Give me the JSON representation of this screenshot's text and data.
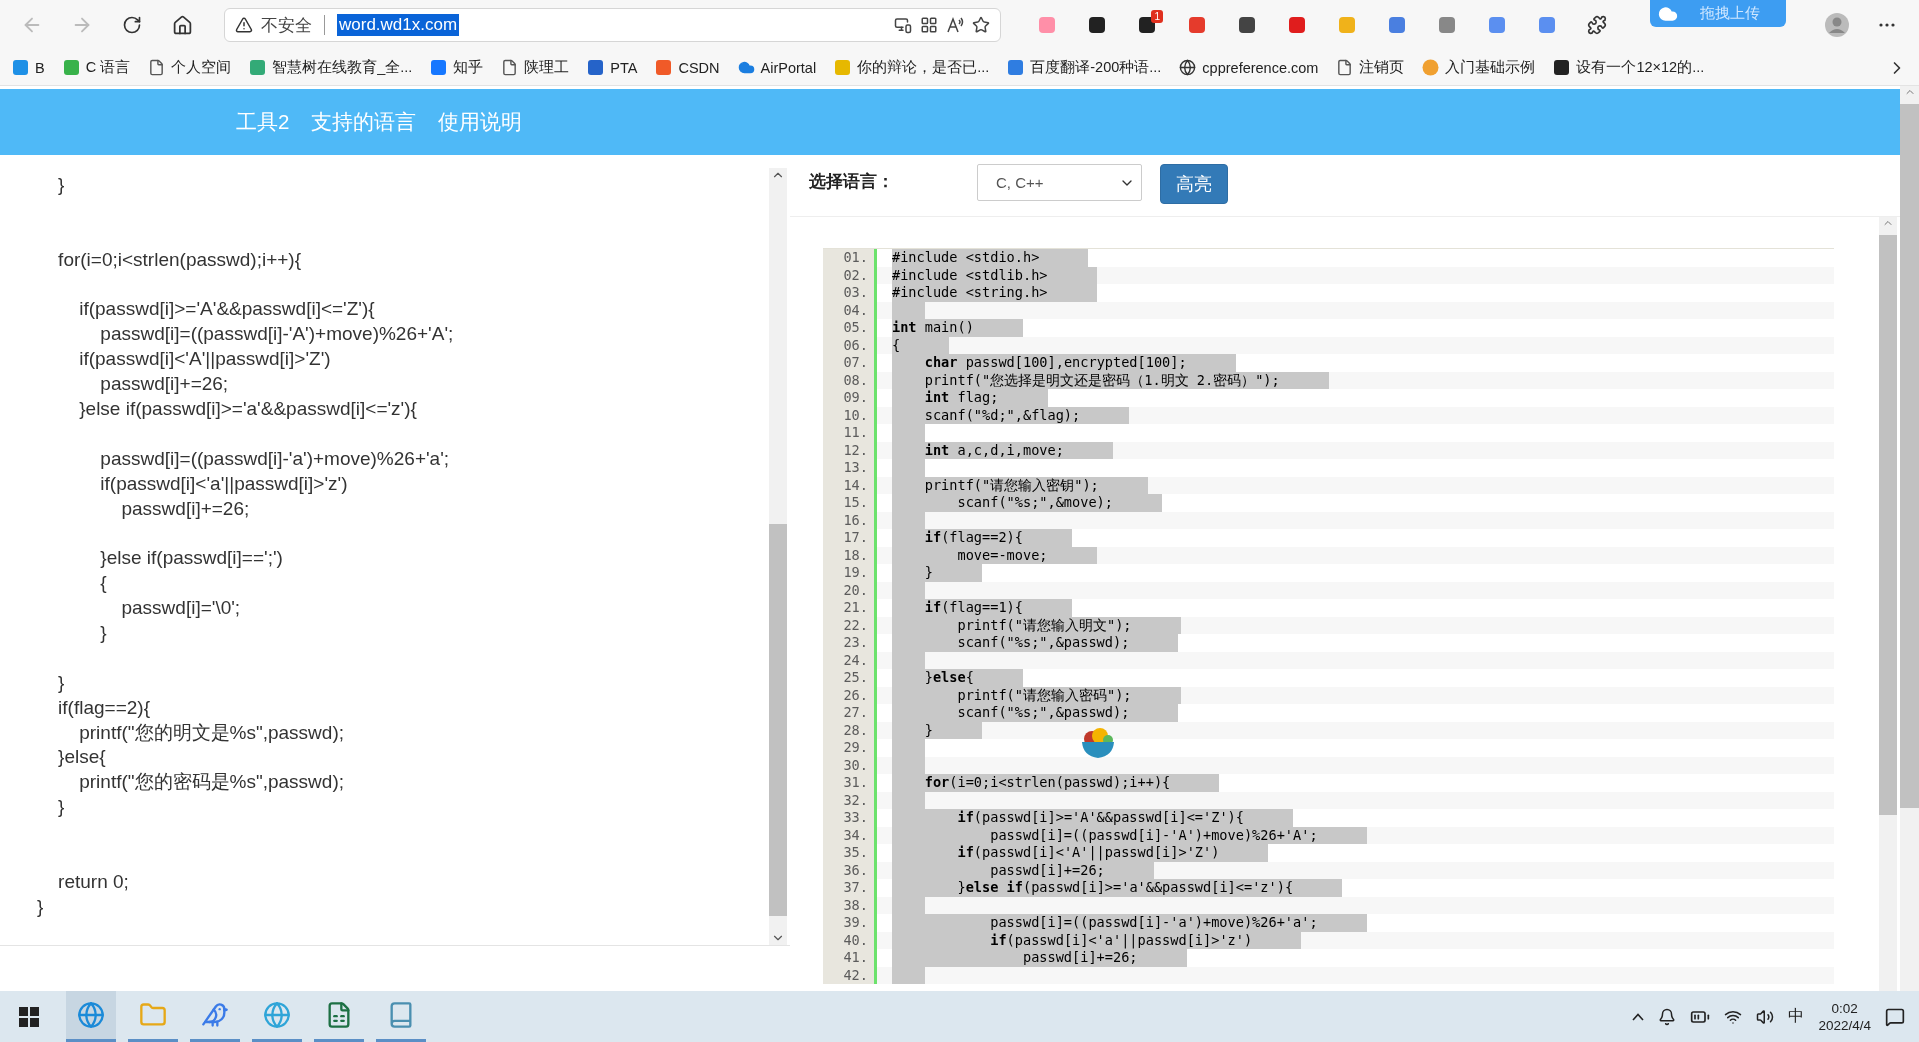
{
  "browser": {
    "security_label": "不安全",
    "url": "word.wd1x.com",
    "url_selected": true,
    "notification_count": "1",
    "upload_badge": "拖拽上传"
  },
  "bookmarks": [
    {
      "label": "B"
    },
    {
      "label": "C 语言"
    },
    {
      "label": "个人空间"
    },
    {
      "label": "智慧树在线教育_全..."
    },
    {
      "label": "知乎"
    },
    {
      "label": "陕理工"
    },
    {
      "label": "PTA"
    },
    {
      "label": "CSDN"
    },
    {
      "label": "AirPortal"
    },
    {
      "label": "你的辩论，是否已..."
    },
    {
      "label": "百度翻译-200种语..."
    },
    {
      "label": "cppreference.com"
    },
    {
      "label": "注销页"
    },
    {
      "label": "入门基础示例"
    },
    {
      "label": "设有一个12×12的..."
    }
  ],
  "nav": [
    {
      "label": "工具2"
    },
    {
      "label": "支持的语言"
    },
    {
      "label": "使用说明"
    }
  ],
  "editor": {
    "lines": [
      {
        "kind": "code",
        "text": "    }"
      },
      {
        "kind": "blank"
      },
      {
        "kind": "blank"
      },
      {
        "kind": "code",
        "text": "    for(i=0;i<strlen(passwd);i++){"
      },
      {
        "kind": "blank"
      },
      {
        "kind": "code",
        "text": "        if(passwd[i]>='A'&&passwd[i]<='Z'){"
      },
      {
        "kind": "code",
        "text": "            passwd[i]=((passwd[i]-'A')+move)%26+'A';"
      },
      {
        "kind": "code",
        "text": "        if(passwd[i]<'A'||passwd[i]>'Z')"
      },
      {
        "kind": "code",
        "text": "            passwd[i]+=26;"
      },
      {
        "kind": "code",
        "text": "        }else if(passwd[i]>='a'&&passwd[i]<='z'){"
      },
      {
        "kind": "blank"
      },
      {
        "kind": "code",
        "text": "            passwd[i]=((passwd[i]-'a')+move)%26+'a';"
      },
      {
        "kind": "code",
        "text": "            if(passwd[i]<'a'||passwd[i]>'z')"
      },
      {
        "kind": "code",
        "text": "                passwd[i]+=26;"
      },
      {
        "kind": "blank"
      },
      {
        "kind": "code",
        "text": "            }else if(passwd[i]==';')"
      },
      {
        "kind": "code",
        "text": "            {"
      },
      {
        "kind": "code",
        "text": "                passwd[i]='\\0';"
      },
      {
        "kind": "code",
        "text": "            }"
      },
      {
        "kind": "blank"
      },
      {
        "kind": "code",
        "text": "    }"
      },
      {
        "kind": "code",
        "text": "    if(flag==2){"
      },
      {
        "kind": "code",
        "text": "        printf(\"您的明文是%s\",passwd);"
      },
      {
        "kind": "code",
        "text": "    }else{"
      },
      {
        "kind": "code",
        "text": "        printf(\"您的密码是%s\",passwd);"
      },
      {
        "kind": "code",
        "text": "    }"
      },
      {
        "kind": "blank"
      },
      {
        "kind": "blank"
      },
      {
        "kind": "code",
        "text": "    return 0;"
      },
      {
        "kind": "code",
        "text": "}"
      }
    ]
  },
  "language": {
    "label": "选择语言：",
    "value": "C, C++"
  },
  "highlight_button": "高亮",
  "code_view": {
    "selected": true,
    "lines": [
      {
        "no": "01.",
        "code": "#include <stdio.h>"
      },
      {
        "no": "02.",
        "code": "#include <stdlib.h>"
      },
      {
        "no": "03.",
        "code": "#include <string.h>"
      },
      {
        "no": "04."
      },
      {
        "no": "05.",
        "code": "**int** main()"
      },
      {
        "no": "06.",
        "code": "{"
      },
      {
        "no": "07.",
        "code": "    **char** passwd[100],encrypted[100];"
      },
      {
        "no": "08.",
        "code": "    printf(\"您选择是明文还是密码（1.明文 2.密码）\");"
      },
      {
        "no": "09.",
        "code": "    **int** flag;"
      },
      {
        "no": "10.",
        "code": "    scanf(\"%d;\",&flag);"
      },
      {
        "no": "11."
      },
      {
        "no": "12.",
        "code": "    **int** a,c,d,i,move;"
      },
      {
        "no": "13."
      },
      {
        "no": "14.",
        "code": "    printf(\"请您输入密钥\");"
      },
      {
        "no": "15.",
        "code": "        scanf(\"%s;\",&move);"
      },
      {
        "no": "16."
      },
      {
        "no": "17.",
        "code": "    **if**(flag==2){"
      },
      {
        "no": "18.",
        "code": "        move=-move;"
      },
      {
        "no": "19.",
        "code": "    }"
      },
      {
        "no": "20."
      },
      {
        "no": "21.",
        "code": "    **if**(flag==1){"
      },
      {
        "no": "22.",
        "code": "        printf(\"请您输入明文\");"
      },
      {
        "no": "23.",
        "code": "        scanf(\"%s;\",&passwd);"
      },
      {
        "no": "24."
      },
      {
        "no": "25.",
        "code": "    }**else**{"
      },
      {
        "no": "26.",
        "code": "        printf(\"请您输入密码\");"
      },
      {
        "no": "27.",
        "code": "        scanf(\"%s;\",&passwd);"
      },
      {
        "no": "28.",
        "code": "    }"
      },
      {
        "no": "29."
      },
      {
        "no": "30."
      },
      {
        "no": "31.",
        "code": "    **for**(i=0;i<strlen(passwd);i++){"
      },
      {
        "no": "32."
      },
      {
        "no": "33.",
        "code": "        **if**(passwd[i]>='A'&&passwd[i]<='Z'){"
      },
      {
        "no": "34.",
        "code": "            passwd[i]=((passwd[i]-'A')+move)%26+'A';"
      },
      {
        "no": "35.",
        "code": "        **if**(passwd[i]<'A'||passwd[i]>'Z')"
      },
      {
        "no": "36.",
        "code": "            passwd[i]+=26;"
      },
      {
        "no": "37.",
        "code": "        }**else** **if**(passwd[i]>='a'&&passwd[i]<='z'){"
      },
      {
        "no": "38."
      },
      {
        "no": "39.",
        "code": "            passwd[i]=((passwd[i]-'a')+move)%26+'a';"
      },
      {
        "no": "40.",
        "code": "            **if**(passwd[i]<'a'||passwd[i]>'z')"
      },
      {
        "no": "41.",
        "code": "                passwd[i]+=26;"
      },
      {
        "no": "42."
      }
    ]
  },
  "taskbar": {
    "apps": [
      {
        "selected": true
      },
      {
        "selected": false
      },
      {
        "selected": false
      },
      {
        "selected": false
      },
      {
        "selected": false
      },
      {
        "selected": false
      }
    ],
    "ime": "中",
    "time": "0:02",
    "date": "2022/4/4"
  }
}
